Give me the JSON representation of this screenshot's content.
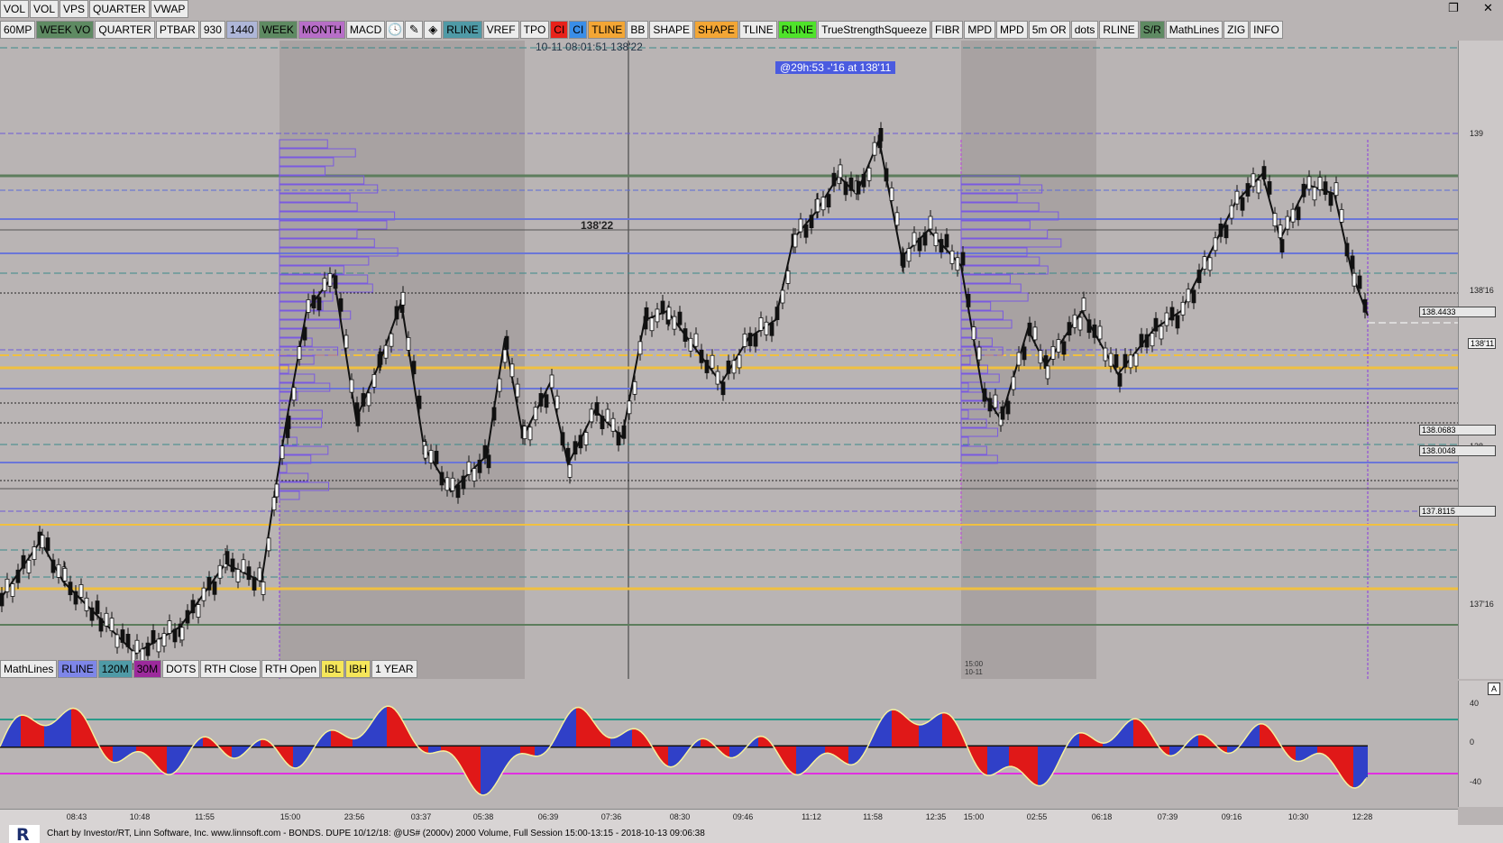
{
  "top_menu": [
    "VOL",
    "VOL",
    "VPS",
    "QUARTER",
    "VWAP"
  ],
  "toolbar": [
    {
      "label": "60MP",
      "bg": "#ececec"
    },
    {
      "label": "WEEK VO",
      "bg": "#5e8a62"
    },
    {
      "label": "QUARTER",
      "bg": "#ececec"
    },
    {
      "label": "PTBAR",
      "bg": "#ececec"
    },
    {
      "label": "930",
      "bg": "#ececec"
    },
    {
      "label": "1440",
      "bg": "#aeb6d8"
    },
    {
      "label": "WEEK",
      "bg": "#5e8a62"
    },
    {
      "label": "MONTH",
      "bg": "#b76ec7"
    },
    {
      "label": "MACD",
      "bg": "#ececec"
    },
    {
      "icon": "clock-icon",
      "glyph": "🕓"
    },
    {
      "icon": "pencil-icon",
      "glyph": "✎"
    },
    {
      "icon": "brush-icon",
      "glyph": "◈"
    },
    {
      "label": "RLINE",
      "bg": "#4f9aa6"
    },
    {
      "label": "VREF",
      "bg": "#ececec"
    },
    {
      "label": "TPO",
      "bg": "#ececec"
    },
    {
      "label": "CI",
      "bg": "#e8221a"
    },
    {
      "label": "CI",
      "bg": "#3a8ee8"
    },
    {
      "label": "TLINE",
      "bg": "#f3a635"
    },
    {
      "label": "BB",
      "bg": "#ececec"
    },
    {
      "label": "SHAPE",
      "bg": "#ececec"
    },
    {
      "label": "SHAPE",
      "bg": "#f3a635"
    },
    {
      "label": "TLINE",
      "bg": "#ececec"
    },
    {
      "label": "RLINE",
      "bg": "#4fe32a"
    },
    {
      "label": "TrueStrengthSqueeze",
      "bg": "#ececec"
    },
    {
      "label": "FIBR",
      "bg": "#ececec"
    },
    {
      "label": "MPD",
      "bg": "#ececec"
    },
    {
      "label": "MPD",
      "bg": "#ececec"
    },
    {
      "label": "5m OR",
      "bg": "#ececec"
    },
    {
      "label": "dots",
      "bg": "#ececec"
    },
    {
      "label": "RLINE",
      "bg": "#ececec"
    },
    {
      "label": "S/R",
      "bg": "#5e8a62"
    },
    {
      "label": "MathLines",
      "bg": "#ececec"
    },
    {
      "label": "ZIG",
      "bg": "#ececec"
    },
    {
      "label": "INFO",
      "bg": "#ececec"
    }
  ],
  "bottom_toolbar": [
    {
      "label": "MathLines",
      "bg": "#ececec"
    },
    {
      "label": "RLINE",
      "bg": "#7e86e8"
    },
    {
      "label": "120M",
      "bg": "#4f9aa6"
    },
    {
      "label": "30M",
      "bg": "#9c2a9c"
    },
    {
      "label": "DOTS",
      "bg": "#ececec"
    },
    {
      "label": "RTH Close",
      "bg": "#ececec"
    },
    {
      "label": "RTH Open",
      "bg": "#ececec"
    },
    {
      "label": "IBL",
      "bg": "#f5e65a"
    },
    {
      "label": "IBH",
      "bg": "#f5e65a"
    },
    {
      "label": "1 YEAR",
      "bg": "#ececec"
    }
  ],
  "crosshair_label": "10-11 08:01:51  138'22",
  "cursor_price": "138'22",
  "alert_label": "@29h:53  -'16 at 138'11",
  "session_label_top": "15:00",
  "session_label_bottom": "10-11",
  "price_scale": [
    "139",
    "138'16",
    "138",
    "137'16"
  ],
  "price_tags": [
    "138.4433",
    "138'11",
    "138.0683",
    "138.0048",
    "137.8115"
  ],
  "osc_scale": [
    "40",
    "0",
    "-40"
  ],
  "osc_button": "A",
  "time_labels": [
    "08:43",
    "10:48",
    "11:55",
    "15:00",
    "23:56",
    "03:37",
    "05:38",
    "06:39",
    "07:36",
    "08:30",
    "09:46",
    "11:12",
    "11:58",
    "12:35",
    "15:00",
    "02:55",
    "06:18",
    "07:39",
    "09:16",
    "10:30",
    "12:28"
  ],
  "footer_text": "Chart by Investor/RT, Linn Software, Inc. www.linnsoft.com - BONDS. DUPE   10/12/18: @US# (2000v) 2000 Volume, Full Session 15:00-13:15 - 2018-10-13 09:06:38",
  "window_controls": [
    "restore-icon",
    "close-icon"
  ]
}
